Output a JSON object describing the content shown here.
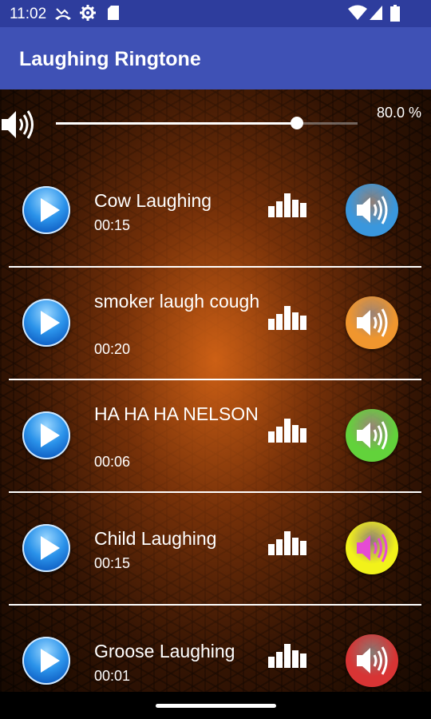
{
  "status_bar": {
    "time": "11:02",
    "left_icons": [
      "missed-call-icon",
      "settings-icon",
      "sd-card-icon"
    ],
    "right_icons": [
      "wifi-icon",
      "signal-icon",
      "battery-icon"
    ]
  },
  "app_bar": {
    "title": "Laughing Ringtone"
  },
  "volume": {
    "level_percent": 80.0,
    "label": "80.0 %",
    "icon": "speaker-icon"
  },
  "ringtones": [
    {
      "title": "Cow Laughing",
      "duration": "00:15",
      "set_color": "#3a97dd",
      "wave_color": "#ffffff"
    },
    {
      "title": "smoker laugh cough",
      "duration": "00:20",
      "set_color": "#f0962e",
      "wave_color": "#ffffff"
    },
    {
      "title": "HA HA HA NELSON",
      "duration": "00:06",
      "set_color": "#62d23b",
      "wave_color": "#ffffff"
    },
    {
      "title": "Child Laughing",
      "duration": "00:15",
      "set_color": "#f2f21a",
      "wave_color": "#e64ad4"
    },
    {
      "title": "Groose Laughing",
      "duration": "00:01",
      "set_color": "#d83434",
      "wave_color": "#ffffff"
    }
  ],
  "colors": {
    "status_bar": "#2e3d9d",
    "app_bar": "#3f51b5"
  }
}
